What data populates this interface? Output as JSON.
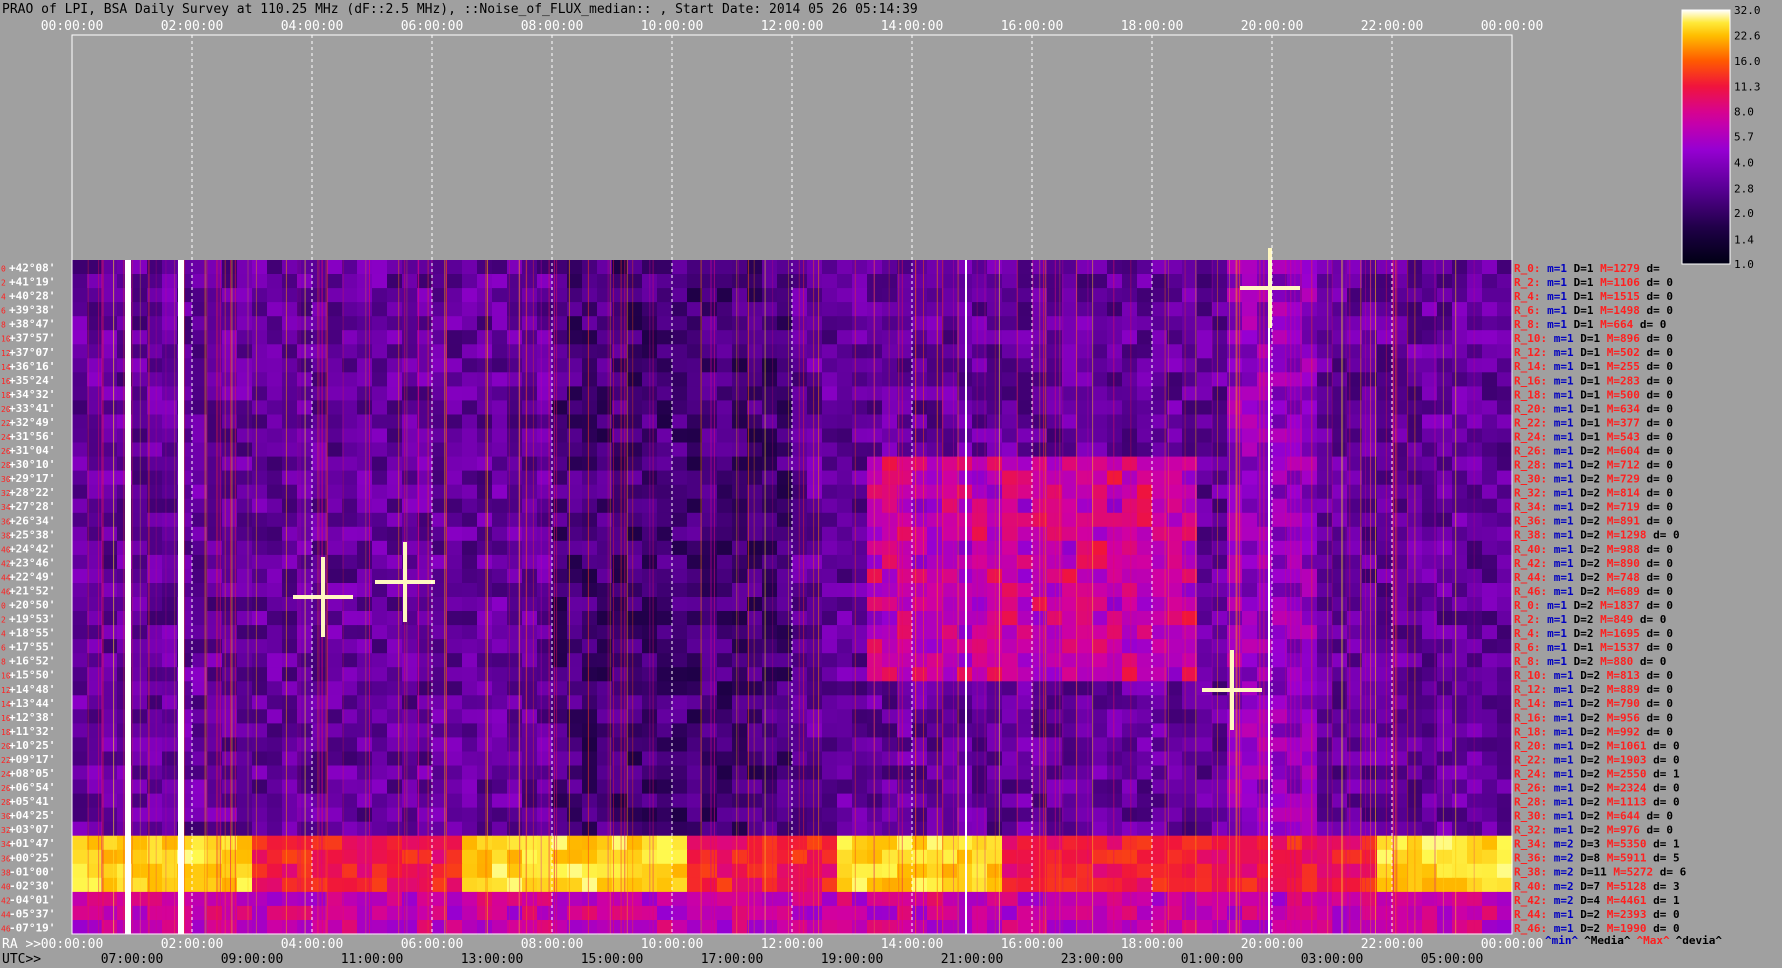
{
  "colors": {
    "background": "#a0a0a0",
    "label_red": "#ff2020",
    "label_blue": "#0000c0",
    "label_black": "#000000",
    "grid": "#ffffff"
  },
  "chart_data": {
    "type": "heatmap",
    "title": "PRAO of LPI, BSA Daily Survey at 110.25 MHz (dF::2.5 MHz), ::Noise_of_FLUX_median:: , Start Date: 2014 05 26 05:14:39",
    "top_axis_ticks": [
      "00:00:00",
      "02:00:00",
      "04:00:00",
      "06:00:00",
      "08:00:00",
      "10:00:00",
      "12:00:00",
      "14:00:00",
      "16:00:00",
      "18:00:00",
      "20:00:00",
      "22:00:00",
      "00:00:00"
    ],
    "ra_axis": {
      "label": "RA >>",
      "ticks": [
        "00:00:00",
        "02:00:00",
        "04:00:00",
        "06:00:00",
        "08:00:00",
        "10:00:00",
        "12:00:00",
        "14:00:00",
        "16:00:00",
        "18:00:00",
        "20:00:00",
        "22:00:00",
        "00:00:00"
      ]
    },
    "utc_axis": {
      "label": "UTC>>",
      "ticks": [
        "07:00:00",
        "09:00:00",
        "11:00:00",
        "13:00:00",
        "15:00:00",
        "17:00:00",
        "19:00:00",
        "21:00:00",
        "23:00:00",
        "01:00:00",
        "03:00:00",
        "05:00:00"
      ]
    },
    "declinations": [
      "+42°08'",
      "+41°19'",
      "+40°28'",
      "+39°38'",
      "+38°47'",
      "+37°57'",
      "+37°07'",
      "+36°16'",
      "+35°24'",
      "+34°32'",
      "+33°41'",
      "+32°49'",
      "+31°56'",
      "+31°04'",
      "+30°10'",
      "+29°17'",
      "+28°22'",
      "+27°28'",
      "+26°34'",
      "+25°38'",
      "+24°42'",
      "+23°46'",
      "+22°49'",
      "+21°52'",
      "+20°50'",
      "+19°53'",
      "+18°55'",
      "+17°55'",
      "+16°52'",
      "+15°50'",
      "+14°48'",
      "+13°44'",
      "+12°38'",
      "+11°32'",
      "+10°25'",
      "+09°17'",
      "+08°05'",
      "+06°54'",
      "+05°41'",
      "+04°25'",
      "+03°07'",
      "+01°47'",
      "+00°25'",
      "-01°00'",
      "-02°30'",
      "-04°01'",
      "-05°37'",
      "-07°19'"
    ],
    "row_index_labels": [
      "0",
      "2",
      "4",
      "6",
      "8",
      "10",
      "12",
      "14",
      "16",
      "18",
      "20",
      "22",
      "24",
      "26",
      "28",
      "30",
      "32",
      "34",
      "36",
      "38",
      "40",
      "42",
      "44",
      "46",
      "0",
      "2",
      "4",
      "6",
      "8",
      "10",
      "12",
      "14",
      "16",
      "18",
      "20",
      "22",
      "24",
      "26",
      "28",
      "30",
      "32",
      "34",
      "36",
      "38",
      "40",
      "42",
      "44",
      "46"
    ],
    "colorbar": {
      "ticks": [
        "32.0",
        "22.6",
        "16.0",
        "11.3",
        "8.0",
        "5.7",
        "4.0",
        "2.8",
        "2.0",
        "1.4",
        "1.0"
      ],
      "scale": "log",
      "range": [
        1.0,
        32.0
      ]
    },
    "row_stats": [
      {
        "R": "R_0:",
        "m": "m=1",
        "D": "D=1",
        "M": "M=1279",
        "d": "d="
      },
      {
        "R": "R_2:",
        "m": "m=1",
        "D": "D=1",
        "M": "M=1106",
        "d": "d= 0"
      },
      {
        "R": "R_4:",
        "m": "m=1",
        "D": "D=1",
        "M": "M=1515",
        "d": "d= 0"
      },
      {
        "R": "R_6:",
        "m": "m=1",
        "D": "D=1",
        "M": "M=1498",
        "d": "d= 0"
      },
      {
        "R": "R_8:",
        "m": "m=1",
        "D": "D=1",
        "M": "M=664",
        "d": "d= 0"
      },
      {
        "R": "R_10:",
        "m": "m=1",
        "D": "D=1",
        "M": "M=896",
        "d": "d= 0"
      },
      {
        "R": "R_12:",
        "m": "m=1",
        "D": "D=1",
        "M": "M=502",
        "d": "d= 0"
      },
      {
        "R": "R_14:",
        "m": "m=1",
        "D": "D=1",
        "M": "M=255",
        "d": "d= 0"
      },
      {
        "R": "R_16:",
        "m": "m=1",
        "D": "D=1",
        "M": "M=283",
        "d": "d= 0"
      },
      {
        "R": "R_18:",
        "m": "m=1",
        "D": "D=1",
        "M": "M=500",
        "d": "d= 0"
      },
      {
        "R": "R_20:",
        "m": "m=1",
        "D": "D=1",
        "M": "M=634",
        "d": "d= 0"
      },
      {
        "R": "R_22:",
        "m": "m=1",
        "D": "D=1",
        "M": "M=377",
        "d": "d= 0"
      },
      {
        "R": "R_24:",
        "m": "m=1",
        "D": "D=1",
        "M": "M=543",
        "d": "d= 0"
      },
      {
        "R": "R_26:",
        "m": "m=1",
        "D": "D=2",
        "M": "M=604",
        "d": "d= 0"
      },
      {
        "R": "R_28:",
        "m": "m=1",
        "D": "D=2",
        "M": "M=712",
        "d": "d= 0"
      },
      {
        "R": "R_30:",
        "m": "m=1",
        "D": "D=2",
        "M": "M=729",
        "d": "d= 0"
      },
      {
        "R": "R_32:",
        "m": "m=1",
        "D": "D=2",
        "M": "M=814",
        "d": "d= 0"
      },
      {
        "R": "R_34:",
        "m": "m=1",
        "D": "D=2",
        "M": "M=719",
        "d": "d= 0"
      },
      {
        "R": "R_36:",
        "m": "m=1",
        "D": "D=2",
        "M": "M=891",
        "d": "d= 0"
      },
      {
        "R": "R_38:",
        "m": "m=1",
        "D": "D=2",
        "M": "M=1298",
        "d": "d= 0"
      },
      {
        "R": "R_40:",
        "m": "m=1",
        "D": "D=2",
        "M": "M=988",
        "d": "d= 0"
      },
      {
        "R": "R_42:",
        "m": "m=1",
        "D": "D=2",
        "M": "M=890",
        "d": "d= 0"
      },
      {
        "R": "R_44:",
        "m": "m=1",
        "D": "D=2",
        "M": "M=748",
        "d": "d= 0"
      },
      {
        "R": "R_46:",
        "m": "m=1",
        "D": "D=2",
        "M": "M=689",
        "d": "d= 0"
      },
      {
        "R": "R_0:",
        "m": "m=1",
        "D": "D=2",
        "M": "M=1837",
        "d": "d= 0"
      },
      {
        "R": "R_2:",
        "m": "m=1",
        "D": "D=2",
        "M": "M=849",
        "d": "d= 0"
      },
      {
        "R": "R_4:",
        "m": "m=1",
        "D": "D=2",
        "M": "M=1695",
        "d": "d= 0"
      },
      {
        "R": "R_6:",
        "m": "m=1",
        "D": "D=1",
        "M": "M=1537",
        "d": "d= 0"
      },
      {
        "R": "R_8:",
        "m": "m=1",
        "D": "D=2",
        "M": "M=880",
        "d": "d= 0"
      },
      {
        "R": "R_10:",
        "m": "m=1",
        "D": "D=2",
        "M": "M=813",
        "d": "d= 0"
      },
      {
        "R": "R_12:",
        "m": "m=1",
        "D": "D=2",
        "M": "M=889",
        "d": "d= 0"
      },
      {
        "R": "R_14:",
        "m": "m=1",
        "D": "D=2",
        "M": "M=790",
        "d": "d= 0"
      },
      {
        "R": "R_16:",
        "m": "m=1",
        "D": "D=2",
        "M": "M=956",
        "d": "d= 0"
      },
      {
        "R": "R_18:",
        "m": "m=1",
        "D": "D=2",
        "M": "M=992",
        "d": "d= 0"
      },
      {
        "R": "R_20:",
        "m": "m=1",
        "D": "D=2",
        "M": "M=1061",
        "d": "d= 0"
      },
      {
        "R": "R_22:",
        "m": "m=1",
        "D": "D=2",
        "M": "M=1903",
        "d": "d= 0"
      },
      {
        "R": "R_24:",
        "m": "m=1",
        "D": "D=2",
        "M": "M=2550",
        "d": "d= 1"
      },
      {
        "R": "R_26:",
        "m": "m=1",
        "D": "D=2",
        "M": "M=2324",
        "d": "d= 0"
      },
      {
        "R": "R_28:",
        "m": "m=1",
        "D": "D=2",
        "M": "M=1113",
        "d": "d= 0"
      },
      {
        "R": "R_30:",
        "m": "m=1",
        "D": "D=2",
        "M": "M=644",
        "d": "d= 0"
      },
      {
        "R": "R_32:",
        "m": "m=1",
        "D": "D=2",
        "M": "M=976",
        "d": "d= 0"
      },
      {
        "R": "R_34:",
        "m": "m=2",
        "D": "D=3",
        "M": "M=5350",
        "d": "d= 1"
      },
      {
        "R": "R_36:",
        "m": "m=2",
        "D": "D=8",
        "M": "M=5911",
        "d": "d= 5"
      },
      {
        "R": "R_38:",
        "m": "m=2",
        "D": "D=11",
        "M": "M=5272",
        "d": "d= 6"
      },
      {
        "R": "R_40:",
        "m": "m=2",
        "D": "D=7",
        "M": "M=5128",
        "d": "d= 3"
      },
      {
        "R": "R_42:",
        "m": "m=2",
        "D": "D=4",
        "M": "M=4461",
        "d": "d= 1"
      },
      {
        "R": "R_44:",
        "m": "m=1",
        "D": "D=2",
        "M": "M=2393",
        "d": "d= 0"
      },
      {
        "R": "R_46:",
        "m": "m=1",
        "D": "D=2",
        "M": "M=1990",
        "d": "d= 0"
      }
    ],
    "stats_legend": [
      "^min^",
      "^Media^",
      "^Max^",
      "^devia^"
    ]
  }
}
